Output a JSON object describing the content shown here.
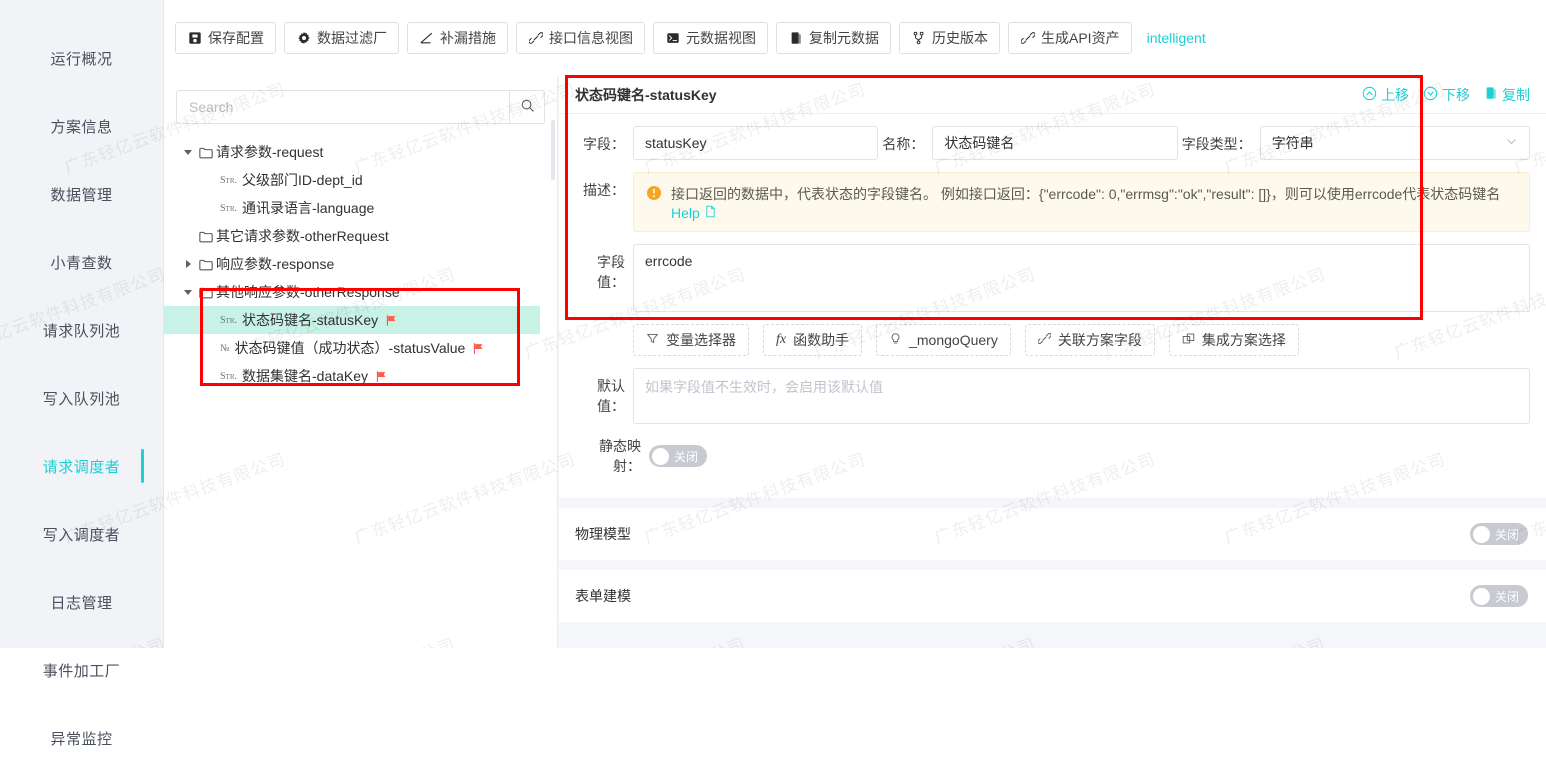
{
  "watermark": {
    "text": "广东轻亿云软件科技有限公司"
  },
  "sidebar": {
    "items": [
      {
        "label": "运行概况",
        "active": false
      },
      {
        "label": "方案信息",
        "active": false
      },
      {
        "label": "数据管理",
        "active": false
      },
      {
        "label": "小青查数",
        "active": false
      },
      {
        "label": "请求队列池",
        "active": false
      },
      {
        "label": "写入队列池",
        "active": false
      },
      {
        "label": "请求调度者",
        "active": true
      },
      {
        "label": "写入调度者",
        "active": false
      },
      {
        "label": "日志管理",
        "active": false
      },
      {
        "label": "事件加工厂",
        "active": false
      },
      {
        "label": "异常监控",
        "active": false
      }
    ]
  },
  "toolbar": {
    "buttons": [
      {
        "label": "保存配置",
        "icon": "save-icon"
      },
      {
        "label": "数据过滤厂",
        "icon": "gear-icon"
      },
      {
        "label": "补漏措施",
        "icon": "chart-line-icon"
      },
      {
        "label": "接口信息视图",
        "icon": "link-icon"
      },
      {
        "label": "元数据视图",
        "icon": "terminal-icon"
      },
      {
        "label": "复制元数据",
        "icon": "copy-icon"
      },
      {
        "label": "历史版本",
        "icon": "branch-icon"
      },
      {
        "label": "生成API资产",
        "icon": "link-icon"
      }
    ],
    "link_label": "intelligent"
  },
  "tree_panel": {
    "search": {
      "value": "",
      "placeholder": "Search"
    },
    "nodes": [
      {
        "label": "请求参数-request",
        "type": "folder",
        "caret": "down",
        "indent": 0,
        "flag": false,
        "highlight": false
      },
      {
        "label": "父级部门ID-dept_id",
        "type": "Str.",
        "caret": "none",
        "indent": 1,
        "flag": false,
        "highlight": false
      },
      {
        "label": "通讯录语言-language",
        "type": "Str.",
        "caret": "none",
        "indent": 1,
        "flag": false,
        "highlight": false
      },
      {
        "label": "其它请求参数-otherRequest",
        "type": "folder",
        "caret": "none",
        "indent": 0,
        "flag": false,
        "highlight": false
      },
      {
        "label": "响应参数-response",
        "type": "folder",
        "caret": "right",
        "indent": 0,
        "flag": false,
        "highlight": false
      },
      {
        "label": "其他响应参数-otherResponse",
        "type": "folder",
        "caret": "down",
        "indent": 0,
        "flag": false,
        "highlight": false
      },
      {
        "label": "状态码键名-statusKey",
        "type": "Str.",
        "caret": "none",
        "indent": 1,
        "flag": true,
        "highlight": true
      },
      {
        "label": "状态码键值（成功状态）-statusValue",
        "type": "№",
        "caret": "none",
        "indent": 1,
        "flag": true,
        "highlight": false
      },
      {
        "label": "数据集键名-dataKey",
        "type": "Str.",
        "caret": "none",
        "indent": 1,
        "flag": true,
        "highlight": false
      }
    ]
  },
  "detail": {
    "title": "状态码键名-statusKey",
    "actions": [
      {
        "label": "上移",
        "icon": "chevron-up-circle-icon"
      },
      {
        "label": "下移",
        "icon": "chevron-down-circle-icon"
      },
      {
        "label": "复制",
        "icon": "copy-icon"
      }
    ],
    "field_label": "字段：",
    "field_value": "statusKey",
    "name_label": "名称：",
    "name_value": "状态码键名",
    "type_label": "字段类型：",
    "type_value": "字符串",
    "desc_label": "描述：",
    "desc_text": "接口返回的数据中，代表状态的字段键名。 例如接口返回：{\"errcode\": 0,\"errmsg\":\"ok\",\"result\": []}，则可以使用errcode代表状态码键名",
    "help_label": "Help",
    "value_label": "字段值：",
    "value_text": "errcode",
    "chips": [
      {
        "label": "变量选择器",
        "icon": "funnel-icon"
      },
      {
        "label": "函数助手",
        "icon": "fx-icon"
      },
      {
        "label": "_mongoQuery",
        "icon": "bulb-icon"
      },
      {
        "label": "关联方案字段",
        "icon": "link-icon"
      },
      {
        "label": "集成方案选择",
        "icon": "layers-icon"
      }
    ],
    "default_label": "默认值：",
    "default_placeholder": "如果字段值不生效时，会启用该默认值",
    "static_map_label": "静态映射：",
    "static_map_state": "关闭",
    "sections": [
      {
        "title": "物理模型",
        "state": "关闭"
      },
      {
        "title": "表单建模",
        "state": "关闭"
      }
    ]
  },
  "colors": {
    "accent": "#1ecfd6",
    "highlight": "#c8f2e6",
    "red_box": "#ff0000",
    "warn_bg": "#fdf9ec",
    "flag": "#ff5a4e"
  }
}
